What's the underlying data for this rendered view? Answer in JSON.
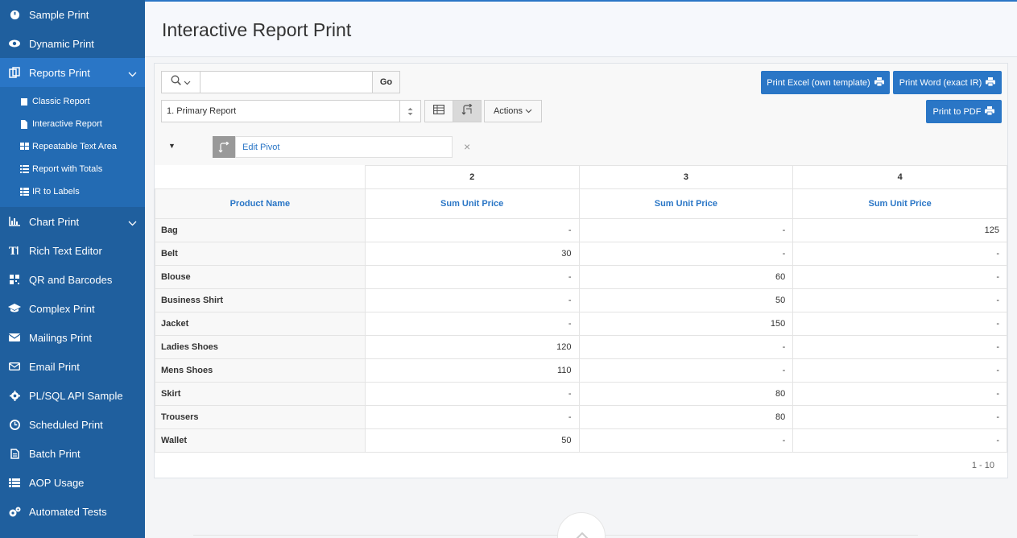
{
  "sidebar": {
    "items_top": [
      {
        "label": "Sample Print",
        "icon": "gauge-icon"
      },
      {
        "label": "Dynamic Print",
        "icon": "eye-icon"
      }
    ],
    "reports": {
      "label": "Reports Print",
      "icon": "copy-icon"
    },
    "subitems": [
      {
        "label": "Classic Report",
        "icon": "edit-icon"
      },
      {
        "label": "Interactive Report",
        "icon": "file-icon"
      },
      {
        "label": "Repeatable Text Area",
        "icon": "grid-icon"
      },
      {
        "label": "Report with Totals",
        "icon": "list-icon"
      },
      {
        "label": "IR to Labels",
        "icon": "labels-icon"
      }
    ],
    "chart": {
      "label": "Chart Print",
      "icon": "bar-chart-icon"
    },
    "items_bottom": [
      {
        "label": "Rich Text Editor",
        "icon": "text-icon"
      },
      {
        "label": "QR and Barcodes",
        "icon": "qr-icon"
      },
      {
        "label": "Complex Print",
        "icon": "graduation-cap-icon"
      },
      {
        "label": "Mailings Print",
        "icon": "envelope-icon"
      },
      {
        "label": "Email Print",
        "icon": "envelope-outline-icon"
      },
      {
        "label": "PL/SQL API Sample",
        "icon": "gear-icon"
      },
      {
        "label": "Scheduled Print",
        "icon": "clock-icon"
      },
      {
        "label": "Batch Print",
        "icon": "file-text-icon"
      },
      {
        "label": "AOP Usage",
        "icon": "list-icon"
      },
      {
        "label": "Automated Tests",
        "icon": "gears-icon"
      }
    ]
  },
  "header": {
    "title": "Interactive Report Print"
  },
  "toolbar": {
    "go_label": "Go",
    "report_select": "1. Primary Report",
    "actions_label": "Actions",
    "print_excel": "Print Excel (own template)",
    "print_word": "Print Word (exact IR)",
    "print_pdf": "Print to PDF"
  },
  "pivot": {
    "edit_label": "Edit Pivot",
    "close": "×"
  },
  "table": {
    "col_groups": [
      "2",
      "3",
      "4"
    ],
    "row_header_label": "Product Name",
    "measure_label": "Sum Unit Price",
    "rows": [
      {
        "name": "Bag",
        "values": [
          "-",
          "-",
          "125"
        ]
      },
      {
        "name": "Belt",
        "values": [
          "30",
          "-",
          "-"
        ]
      },
      {
        "name": "Blouse",
        "values": [
          "-",
          "60",
          "-"
        ]
      },
      {
        "name": "Business Shirt",
        "values": [
          "-",
          "50",
          "-"
        ]
      },
      {
        "name": "Jacket",
        "values": [
          "-",
          "150",
          "-"
        ]
      },
      {
        "name": "Ladies Shoes",
        "values": [
          "120",
          "-",
          "-"
        ]
      },
      {
        "name": "Mens Shoes",
        "values": [
          "110",
          "-",
          "-"
        ]
      },
      {
        "name": "Skirt",
        "values": [
          "-",
          "80",
          "-"
        ]
      },
      {
        "name": "Trousers",
        "values": [
          "-",
          "80",
          "-"
        ]
      },
      {
        "name": "Wallet",
        "values": [
          "50",
          "-",
          "-"
        ]
      }
    ]
  },
  "pager": "1 - 10",
  "colors": {
    "sidebar": "#1f5f9e",
    "accent": "#2a76c6",
    "sidebar_sub": "#236bb3"
  }
}
